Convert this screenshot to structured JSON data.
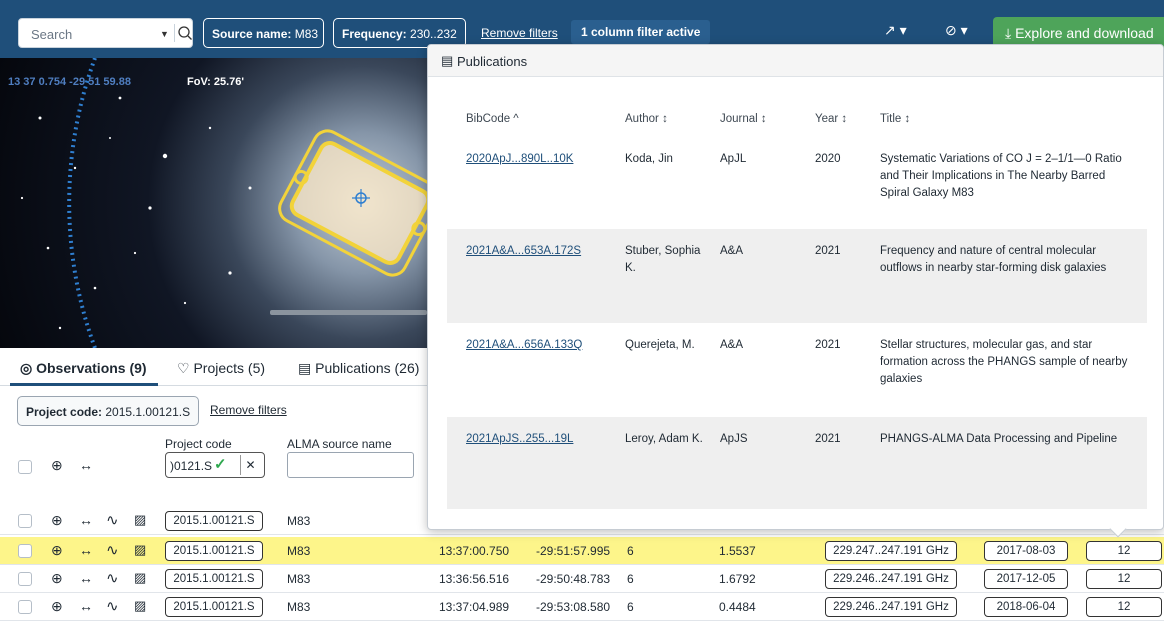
{
  "search": {
    "placeholder": "Search"
  },
  "filters": {
    "source_name_label": "Source name:",
    "source_name_value": "M83",
    "frequency_label": "Frequency:",
    "frequency_value": "230..232",
    "remove_filters": "Remove filters",
    "column_filter_active": "1 column filter active"
  },
  "toolbar": {
    "explore_download": "Explore and download"
  },
  "sky": {
    "coords": "13 37 0.754 -29 51 59.88",
    "fov": "FoV: 25.76'"
  },
  "tabs": [
    {
      "label": "Observations (9)",
      "icon": "eye-icon"
    },
    {
      "label": "Projects (5)",
      "icon": "bulb-icon"
    },
    {
      "label": "Publications (26)",
      "icon": "book-icon"
    }
  ],
  "project_filter": {
    "label": "Project code:",
    "value": "2015.1.00121.S",
    "remove": "Remove filters"
  },
  "table": {
    "headers": {
      "project_code": "Project code",
      "source_name": "ALMA source name"
    },
    "project_code_input": ")0121.S",
    "rows": [
      {
        "project": "2015.1.00121.S",
        "source": "M83",
        "ra": "",
        "dec": "",
        "n": "",
        "val": "",
        "freq": "",
        "date": "",
        "count": "",
        "highlight": false
      },
      {
        "project": "2015.1.00121.S",
        "source": "M83",
        "ra": "13:37:00.750",
        "dec": "-29:51:57.995",
        "n": "6",
        "val": "1.5537",
        "freq": "229.247..247.191 GHz",
        "date": "2017-08-03",
        "count": "12",
        "highlight": true
      },
      {
        "project": "2015.1.00121.S",
        "source": "M83",
        "ra": "13:36:56.516",
        "dec": "-29:50:48.783",
        "n": "6",
        "val": "1.6792",
        "freq": "229.246..247.191 GHz",
        "date": "2017-12-05",
        "count": "12",
        "highlight": false
      },
      {
        "project": "2015.1.00121.S",
        "source": "M83",
        "ra": "13:37:04.989",
        "dec": "-29:53:08.580",
        "n": "6",
        "val": "0.4484",
        "freq": "229.246..247.191 GHz",
        "date": "2018-06-04",
        "count": "12",
        "highlight": false
      }
    ]
  },
  "publications_popup": {
    "title": "Publications",
    "columns": [
      "BibCode ^",
      "Author ↕",
      "Journal ↕",
      "Year ↕",
      "Title ↕"
    ],
    "rows": [
      {
        "bibcode": "2020ApJ...890L..10K",
        "author": "Koda, Jin",
        "journal": "ApJL",
        "year": "2020",
        "title": "Systematic Variations of CO J = 2–1/1—0 Ratio and Their Implications in The Nearby Barred Spiral Galaxy M83"
      },
      {
        "bibcode": "2021A&A...653A.172S",
        "author": "Stuber, Sophia K.",
        "journal": "A&A",
        "year": "2021",
        "title": "Frequency and nature of central molecular outflows in nearby star-forming disk galaxies"
      },
      {
        "bibcode": "2021A&A...656A.133Q",
        "author": "Querejeta, M.",
        "journal": "A&A",
        "year": "2021",
        "title": "Stellar structures, molecular gas, and star formation across the PHANGS sample of nearby galaxies"
      },
      {
        "bibcode": "2021ApJS..255...19L",
        "author": "Leroy, Adam K.",
        "journal": "ApJS",
        "year": "2021",
        "title": "PHANGS-ALMA Data Processing and Pipeline"
      }
    ]
  }
}
